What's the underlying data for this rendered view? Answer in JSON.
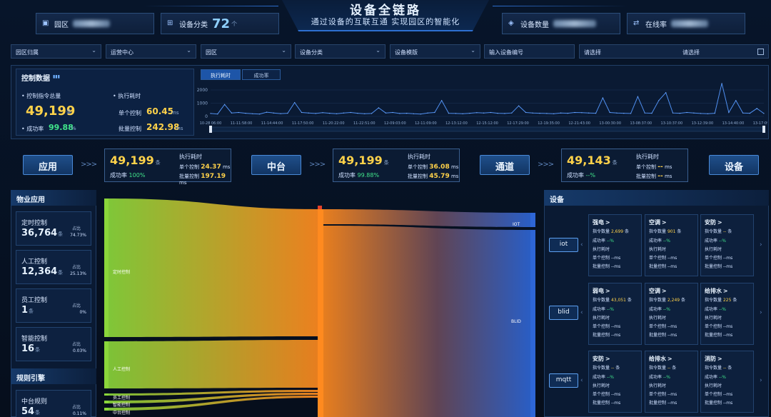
{
  "header": {
    "title": "设备全链路",
    "subtitle": "通过设备的互联互通 实现园区的智能化",
    "park_label": "园区",
    "category_label": "设备分类",
    "category_value": "72",
    "category_unit": "个",
    "device_count_label": "设备数量",
    "online_rate_label": "在线率"
  },
  "filters": {
    "park_owner": "园区归属",
    "ops_center": "运营中心",
    "park": "园区",
    "device_category": "设备分类",
    "device_template": "设备模版",
    "device_no_placeholder": "输入设备编号",
    "select_start": "请选择",
    "select_end": "请选择"
  },
  "control": {
    "title": "控制数据",
    "total_label": "控制指令总量",
    "total_value": "49,199",
    "total_unit": "条",
    "success_label": "成功率",
    "success_value": "99.88",
    "success_unit": "%",
    "exec_label": "执行耗时",
    "single_label": "单个控制",
    "single_value": "60.45",
    "single_unit": "ms",
    "batch_label": "批量控制",
    "batch_value": "242.98",
    "batch_unit": "ms",
    "tabs": [
      "执行耗时",
      "成功率"
    ]
  },
  "chart_data": {
    "type": "line",
    "title": "",
    "ylim": [
      0,
      2000
    ],
    "y_ticks": [
      "2000",
      "1000",
      "0"
    ],
    "x_ticks": [
      "10-28 06:00",
      "11-11:58:00",
      "11-14:44:00",
      "11-17:50:00",
      "11-20:22:00",
      "11-22:51:00",
      "12-09:03:00",
      "12-11:09:00",
      "12-13:12:00",
      "12-15:12:00",
      "12-17:29:00",
      "12-19:35:00",
      "12-21:43:00",
      "13-00:30:00",
      "13-08:37:00",
      "13-10:37:00",
      "13-12:39:00",
      "13-14:40:00",
      "13-17:09:00"
    ],
    "series": [
      {
        "values": [
          220,
          180,
          900,
          260,
          300,
          240,
          200,
          180,
          320,
          260,
          210,
          240,
          1050,
          300,
          260,
          220,
          280,
          240,
          200,
          260,
          300,
          240,
          200,
          220,
          650,
          260,
          300,
          220,
          240,
          200,
          180,
          260,
          300,
          1200,
          240,
          220,
          200,
          240,
          280,
          260,
          300,
          240,
          220,
          260,
          800,
          300,
          260,
          240,
          220,
          200,
          260,
          240,
          300,
          280,
          260,
          240,
          1400,
          300,
          260,
          240,
          220,
          1500,
          260,
          240,
          1200,
          1800,
          260,
          240,
          300,
          260,
          220,
          200,
          240,
          2500,
          300,
          1200,
          260,
          240,
          600,
          220
        ]
      }
    ]
  },
  "flow": {
    "app_label": "应用",
    "mid_label": "中台",
    "channel_label": "通道",
    "device_label": "设备",
    "arrows": ">>>",
    "box1": {
      "count": "49,199",
      "unit": "条",
      "rate_label": "成功率",
      "rate": "100%",
      "exec": "执行耗时",
      "single_label": "单个控制",
      "single": "24.37",
      "batch_label": "批量控制",
      "batch": "197.19",
      "ms": "ms"
    },
    "box2": {
      "count": "49,199",
      "unit": "条",
      "rate_label": "成功率",
      "rate": "99.88%",
      "exec": "执行耗时",
      "single_label": "单个控制",
      "single": "36.08",
      "batch_label": "批量控制",
      "batch": "45.79",
      "ms": "ms"
    },
    "box3": {
      "count": "49,143",
      "unit": "条",
      "rate_label": "成功率",
      "rate": "--%",
      "exec": "执行耗时",
      "single_label": "单个控制",
      "single": "--",
      "batch_label": "批量控制",
      "batch": "--",
      "ms": "ms"
    }
  },
  "apps": {
    "title": "物业应用",
    "ratio_label": "占比",
    "items": [
      {
        "name": "定时控制",
        "value": "36,764",
        "unit": "条",
        "ratio": "74.73%"
      },
      {
        "name": "人工控制",
        "value": "12,364",
        "unit": "条",
        "ratio": "25.13%"
      },
      {
        "name": "员工控制",
        "value": "1",
        "unit": "条",
        "ratio": "0%"
      },
      {
        "name": "智能控制",
        "value": "16",
        "unit": "条",
        "ratio": "0.03%"
      }
    ]
  },
  "rules": {
    "title": "规则引擎",
    "items": [
      {
        "name": "中台规则",
        "value": "54",
        "unit": "条",
        "ratio": "0.11%"
      }
    ]
  },
  "sankey": {
    "sources": [
      "定时控制",
      "人工控制",
      "员工控制",
      "智能控制",
      "中台控制"
    ],
    "targets": [
      "IOT",
      "BLID"
    ]
  },
  "devices": {
    "title": "设备",
    "protocols": [
      "iot",
      "blid",
      "mqtt"
    ],
    "labels": {
      "cmd": "指令数量",
      "rate": "成功率",
      "exec": "执行耗时",
      "single": "单个控制",
      "batch": "批量控制",
      "unit": "条",
      "ms": "--ms"
    },
    "cards": [
      {
        "name": "强电",
        "cmd": "2,699",
        "rate": "--%"
      },
      {
        "name": "空调",
        "cmd": "901",
        "rate": "--%"
      },
      {
        "name": "安防",
        "cmd": "--",
        "rate": "--%"
      },
      {
        "name": "弱电",
        "cmd": "43,051",
        "rate": "--%"
      },
      {
        "name": "空调",
        "cmd": "2,249",
        "rate": "--%"
      },
      {
        "name": "给排水",
        "cmd": "225",
        "rate": "--%"
      },
      {
        "name": "安防",
        "cmd": "--",
        "rate": "--%"
      },
      {
        "name": "给排水",
        "cmd": "--",
        "rate": "--%"
      },
      {
        "name": "消防",
        "cmd": "--",
        "rate": "--%"
      }
    ]
  },
  "colors": {
    "accent": "#2d6fd0",
    "highlight": "#ffd24a",
    "success": "#40e48a",
    "sankey_green": "#8ad63a",
    "sankey_orange": "#ff8a1f",
    "sankey_blue": "#2e66d6"
  }
}
